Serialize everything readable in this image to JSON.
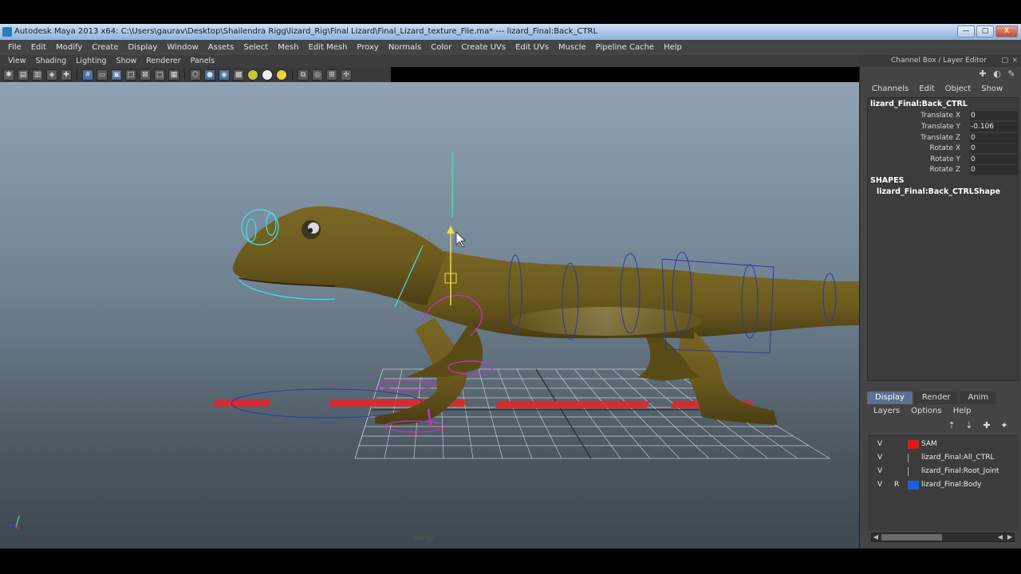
{
  "window": {
    "title": "Autodesk Maya 2013 x64: C:\\Users\\gaurav\\Desktop\\Shailendra Rigg\\lizard_Rig\\Final Lizard\\Final_Lizard_texture_File.ma*   ---   lizard_Final:Back_CTRL",
    "min_label": "—",
    "max_label": "□",
    "close_label": "X"
  },
  "main_menu": [
    "File",
    "Edit",
    "Modify",
    "Create",
    "Display",
    "Window",
    "Assets",
    "Select",
    "Mesh",
    "Edit Mesh",
    "Proxy",
    "Normals",
    "Color",
    "Create UVs",
    "Edit UVs",
    "Muscle",
    "Pipeline Cache",
    "Help"
  ],
  "panel_menu": [
    "View",
    "Shading",
    "Lighting",
    "Show",
    "Renderer",
    "Panels"
  ],
  "viewport": {
    "camera_label": "persp",
    "floor_text": "SAM",
    "colors": {
      "skin": "#6b5a1e",
      "control_cyan": "#38e6e6",
      "control_magenta": "#d02cc8",
      "control_blue": "#2a3aa0",
      "grid": "#e0e0e0",
      "floor_text": "#e0262a"
    }
  },
  "channel_box": {
    "title": "Channel Box / Layer Editor",
    "menu": [
      "Channels",
      "Edit",
      "Object",
      "Show"
    ],
    "node": "lizard_Final:Back_CTRL",
    "attributes": [
      {
        "label": "Translate X",
        "value": "0"
      },
      {
        "label": "Translate Y",
        "value": "-0.106"
      },
      {
        "label": "Translate Z",
        "value": "0"
      },
      {
        "label": "Rotate X",
        "value": "0"
      },
      {
        "label": "Rotate Y",
        "value": "0"
      },
      {
        "label": "Rotate Z",
        "value": "0"
      }
    ],
    "shapes_header": "SHAPES",
    "shape_name": "lizard_Final:Back_CTRLShape"
  },
  "layer_editor": {
    "tabs": [
      "Display",
      "Render",
      "Anim"
    ],
    "active_tab": "Display",
    "menu": [
      "Layers",
      "Options",
      "Help"
    ],
    "layers": [
      {
        "visible": "V",
        "ref": "",
        "color": "#e01818",
        "name": "SAM"
      },
      {
        "visible": "V",
        "ref": "",
        "color": "",
        "name": "lizard_Final:All_CTRL"
      },
      {
        "visible": "V",
        "ref": "",
        "color": "",
        "name": "lizard_Final:Root_Joint"
      },
      {
        "visible": "V",
        "ref": "R",
        "color": "#1e5ee0",
        "name": "lizard_Final:Body"
      }
    ]
  }
}
